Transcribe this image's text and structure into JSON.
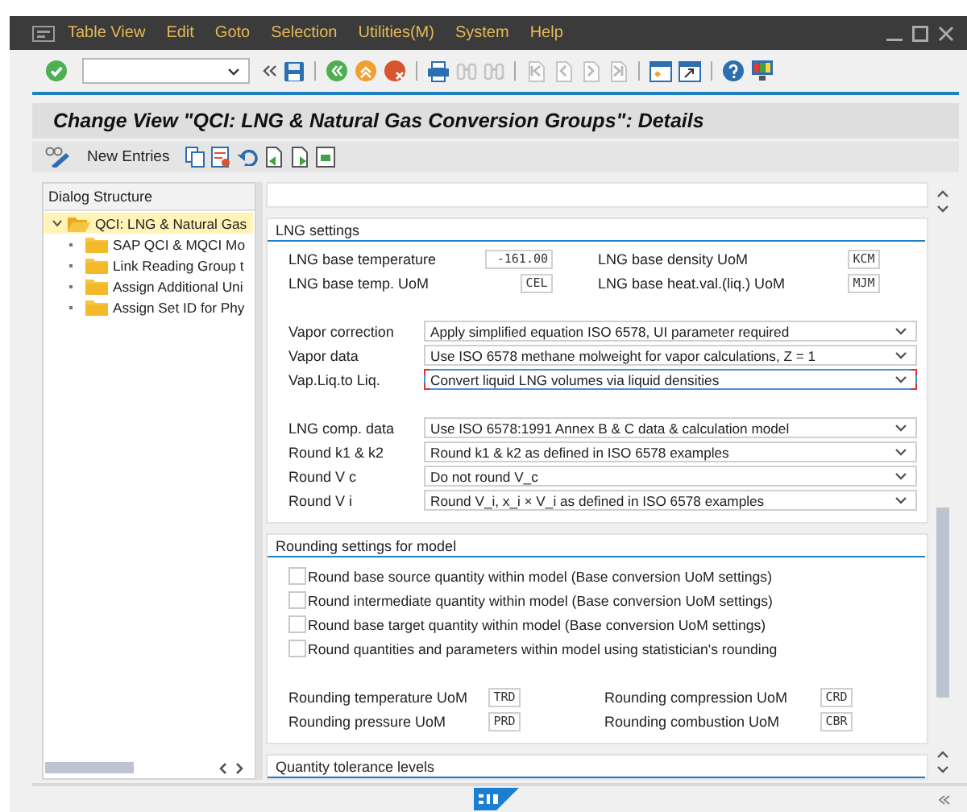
{
  "menu_bar": {
    "items": [
      {
        "label": "Table View"
      },
      {
        "label": "Edit"
      },
      {
        "label": "Goto"
      },
      {
        "label": "Selection"
      },
      {
        "label": "Utilities(M)"
      },
      {
        "label": "System"
      },
      {
        "label": "Help"
      }
    ]
  },
  "title": "Change View \"QCI: LNG & Natural Gas Conversion Groups\": Details",
  "application_toolbar": {
    "buttons": [
      {
        "label": "New Entries"
      }
    ]
  },
  "dialog_structure": {
    "title": "Dialog Structure",
    "tree": [
      {
        "label": "QCI: LNG & Natural Gas",
        "expanded": true,
        "selected": true,
        "children": [
          {
            "label": "SAP QCI & MQCI Mo",
            "selected": false
          },
          {
            "label": "Link Reading Group t",
            "selected": false
          },
          {
            "label": "Assign Additional Uni",
            "selected": false
          },
          {
            "label": "Assign Set ID for Phy",
            "selected": false
          }
        ]
      }
    ]
  },
  "lng_settings": {
    "title": "LNG settings",
    "fields": [
      {
        "label": "LNG base temperature",
        "value": "-161.00",
        "kind": "number"
      },
      {
        "label": "LNG base density UoM",
        "value": "KCM",
        "kind": "unit"
      },
      {
        "label": "LNG base temp. UoM",
        "value": "CEL",
        "kind": "unit"
      },
      {
        "label": "LNG base heat.val.(liq.) UoM",
        "value": "MJM",
        "kind": "unit"
      }
    ],
    "dropdown_groups": [
      [
        {
          "label": "Vapor correction",
          "value": "Apply simplified equation  ISO 6578, UI parameter required",
          "focused": false
        },
        {
          "label": "Vapor data",
          "value": "Use ISO 6578 methane molweight for vapor calculations, Z = 1",
          "focused": false
        },
        {
          "label": "Vap.Liq.to Liq.",
          "value": "Convert liquid LNG volumes via liquid densities",
          "focused": true
        }
      ],
      [
        {
          "label": "LNG comp. data",
          "value": "Use ISO 6578:1991 Annex B & C data & calculation model",
          "focused": false
        },
        {
          "label": "Round k1 & k2",
          "value": "Round k1 & k2 as defined in ISO 6578 examples",
          "focused": false
        },
        {
          "label": "Round V c",
          "value": "Do not round  V_c",
          "focused": false
        },
        {
          "label": "Round V i",
          "value": "Round V_i, x_i × V_i as defined in ISO 6578 examples",
          "focused": false
        }
      ]
    ]
  },
  "rounding_settings": {
    "title": "Rounding settings for model",
    "checkboxes": [
      {
        "label": "Round base source quantity within model (Base conversion UoM settings)",
        "checked": false
      },
      {
        "label": "Round intermediate quantity within model (Base conversion UoM settings)",
        "checked": false
      },
      {
        "label": "Round base target quantity within model (Base conversion UoM settings)",
        "checked": false
      },
      {
        "label": "Round quantities and parameters within model using statistician's rounding",
        "checked": false
      }
    ],
    "fields": [
      {
        "label": "Rounding temperature UoM",
        "value": "TRD"
      },
      {
        "label": "Rounding compression UoM",
        "value": "CRD"
      },
      {
        "label": "Rounding pressure UoM",
        "value": "PRD"
      },
      {
        "label": "Rounding combustion UoM",
        "value": "CBR"
      }
    ]
  },
  "quantity_tolerance": {
    "title": "Quantity tolerance levels"
  }
}
